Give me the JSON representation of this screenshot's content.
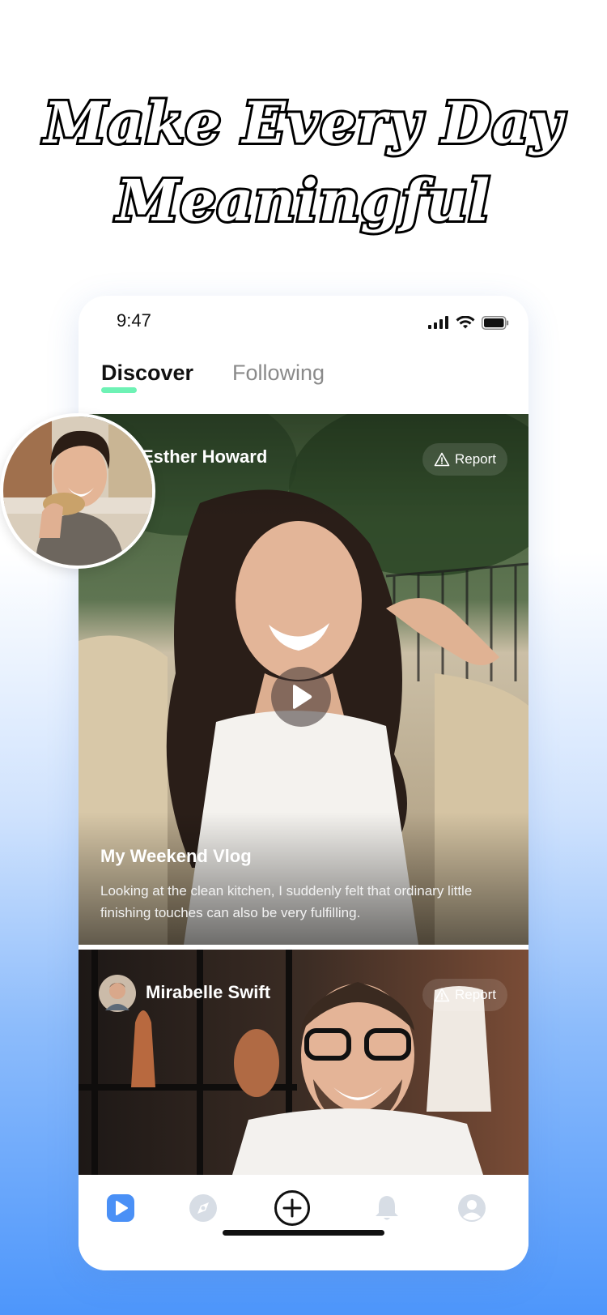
{
  "headline": {
    "line1": "Make Every Day",
    "line2": "Meaningful"
  },
  "status_bar": {
    "time": "9:47"
  },
  "tabs": [
    {
      "label": "Discover",
      "active": true
    },
    {
      "label": "Following",
      "active": false
    }
  ],
  "feed": [
    {
      "author": "Esther Howard",
      "report_label": "Report",
      "title": "My Weekend Vlog",
      "description": "Looking at the clean kitchen, I suddenly felt that ordinary little finishing touches can also be very fulfilling."
    },
    {
      "author": "Mirabelle Swift",
      "report_label": "Report"
    }
  ],
  "bottom_nav": [
    {
      "icon": "video-play-icon",
      "active": true
    },
    {
      "icon": "explore-icon",
      "active": false
    },
    {
      "icon": "add-circle-icon",
      "active": false
    },
    {
      "icon": "bell-icon",
      "active": false
    },
    {
      "icon": "profile-icon",
      "active": false
    }
  ],
  "colors": {
    "accent_tab": "#6ef2b5",
    "nav_active": "#4a90f6",
    "nav_inactive": "#d7dde5",
    "background_bottom": "#4d96fb"
  }
}
